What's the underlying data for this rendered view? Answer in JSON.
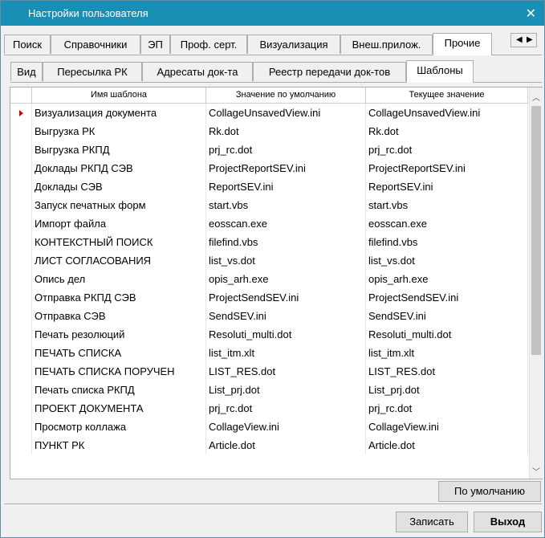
{
  "window": {
    "title": "Настройки пользователя"
  },
  "tabs_top": [
    "Поиск",
    "Справочники",
    "ЭП",
    "Проф. серт.",
    "Визуализация",
    "Внеш.прилож.",
    "Прочие"
  ],
  "tabs_top_active": "Прочие",
  "tabs_sub": [
    "Вид",
    "Пересылка РК",
    "Адресаты док-та",
    "Реестр передачи док-тов",
    "Шаблоны"
  ],
  "tabs_sub_active": "Шаблоны",
  "columns": [
    "Имя шаблона",
    "Значение по умолчанию",
    "Текущее значение"
  ],
  "rows": [
    [
      "Визуализация документа",
      "CollageUnsavedView.ini",
      "CollageUnsavedView.ini"
    ],
    [
      "Выгрузка РК",
      "Rk.dot",
      "Rk.dot"
    ],
    [
      "Выгрузка РКПД",
      "prj_rc.dot",
      "prj_rc.dot"
    ],
    [
      "Доклады РКПД СЭВ",
      "ProjectReportSEV.ini",
      "ProjectReportSEV.ini"
    ],
    [
      "Доклады СЭВ",
      "ReportSEV.ini",
      "ReportSEV.ini"
    ],
    [
      "Запуск печатных форм",
      "start.vbs",
      "start.vbs"
    ],
    [
      "Импорт файла",
      "eosscan.exe",
      "eosscan.exe"
    ],
    [
      "КОНТЕКСТНЫЙ ПОИСК",
      "filefind.vbs",
      "filefind.vbs"
    ],
    [
      "ЛИСТ СОГЛАСОВАНИЯ",
      "list_vs.dot",
      "list_vs.dot"
    ],
    [
      "Опись дел",
      "opis_arh.exe",
      "opis_arh.exe"
    ],
    [
      "Отправка РКПД СЭВ",
      "ProjectSendSEV.ini",
      "ProjectSendSEV.ini"
    ],
    [
      "Отправка СЭВ",
      "SendSEV.ini",
      "SendSEV.ini"
    ],
    [
      "Печать резолюций",
      "Resoluti_multi.dot",
      "Resoluti_multi.dot"
    ],
    [
      "ПЕЧАТЬ СПИСКА",
      "list_itm.xlt",
      "list_itm.xlt"
    ],
    [
      "ПЕЧАТЬ СПИСКА ПОРУЧЕН",
      "LIST_RES.dot",
      "LIST_RES.dot"
    ],
    [
      "Печать списка РКПД",
      "List_prj.dot",
      "List_prj.dot"
    ],
    [
      "ПРОЕКТ ДОКУМЕНТА",
      "prj_rc.dot",
      "prj_rc.dot"
    ],
    [
      "Просмотр коллажа",
      "CollageView.ini",
      "CollageView.ini"
    ],
    [
      "ПУНКТ РК",
      "Article.dot",
      "Article.dot"
    ]
  ],
  "selected_row": 0,
  "buttons": {
    "default": "По умолчанию",
    "save": "Записать",
    "exit": "Выход"
  },
  "icons": {
    "close": "close-icon",
    "tab_scroll": "tab-scroll-arrows-icon",
    "row_marker": "current-row-marker-icon"
  }
}
